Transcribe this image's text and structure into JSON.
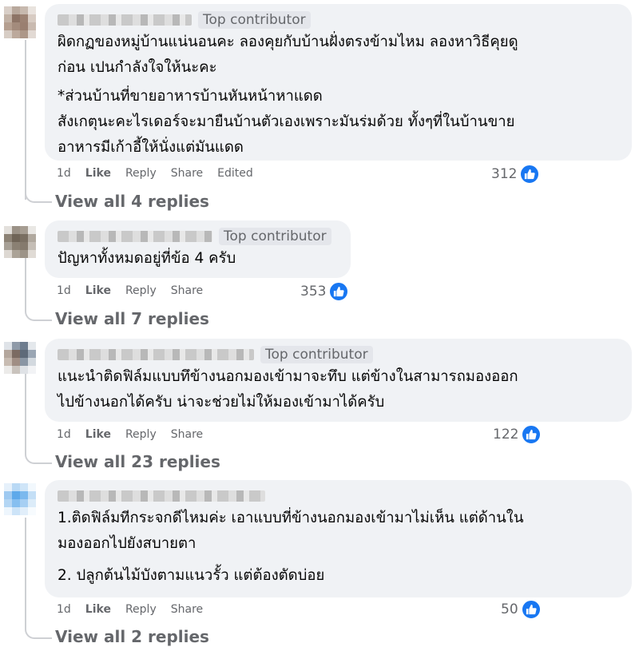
{
  "comments": [
    {
      "badge": "Top contributor",
      "lines": [
        "ผิดกฏของหมู่บ้านแน่นอนคะ ลองคุยกับบ้านฝั่งตรงข้ามไหม ลองหาวิธีคุยดู",
        "ก่อน เปนกำลังใจให้นะคะ",
        "*ส่วนบ้านที่ขายอาหารบ้านหันหน้าหาแดด",
        "สังเกตุนะคะไรเดอร์จะมายืนบ้านตัวเองเพราะมันร่มด้วย ทั้งๆที่ในบ้านขาย",
        "อาหารมีเก้าอี้ให้นั่งแต่มันแดด"
      ],
      "time": "1d",
      "like": "Like",
      "reply": "Reply",
      "share": "Share",
      "edited": "Edited",
      "reaction_count": "312",
      "view_replies": "View all 4 replies"
    },
    {
      "badge": "Top contributor",
      "lines": [
        "ปัญหาทั้งหมดอยู่ที่ข้อ 4 ครับ"
      ],
      "time": "1d",
      "like": "Like",
      "reply": "Reply",
      "share": "Share",
      "reaction_count": "353",
      "view_replies": "View all 7 replies"
    },
    {
      "badge": "Top contributor",
      "lines": [
        "แนะนำติดฟิล์มแบบทึข้างนอกมองเข้ามาจะทึบ แต่ข้างในสามารถมองออก",
        "ไปข้างนอกได้ครับ น่าจะช่วยไม่ให้มองเข้ามาได้ครับ"
      ],
      "time": "1d",
      "like": "Like",
      "reply": "Reply",
      "share": "Share",
      "reaction_count": "122",
      "view_replies": "View all 23 replies"
    },
    {
      "lines": [
        "1.ติดฟิล์มทีกระจกดีไหมค่ะ เอาแบบที่ข้างนอกมองเข้ามาไม่เห็น แต่ด้านใน",
        "มองออกไปยังสบายตา",
        "2. ปลูกต้นไม้บังตามแนวรั้ว แต่ต้องตัดบ่อย"
      ],
      "time": "1d",
      "like": "Like",
      "reply": "Reply",
      "share": "Share",
      "reaction_count": "50",
      "view_replies": "View all 2 replies"
    }
  ],
  "icons": {
    "reaction": "thumbs-up-icon"
  },
  "colors": {
    "like_blue": "#1877f2",
    "bubble": "#f0f2f5",
    "meta_gray": "#65676b"
  }
}
